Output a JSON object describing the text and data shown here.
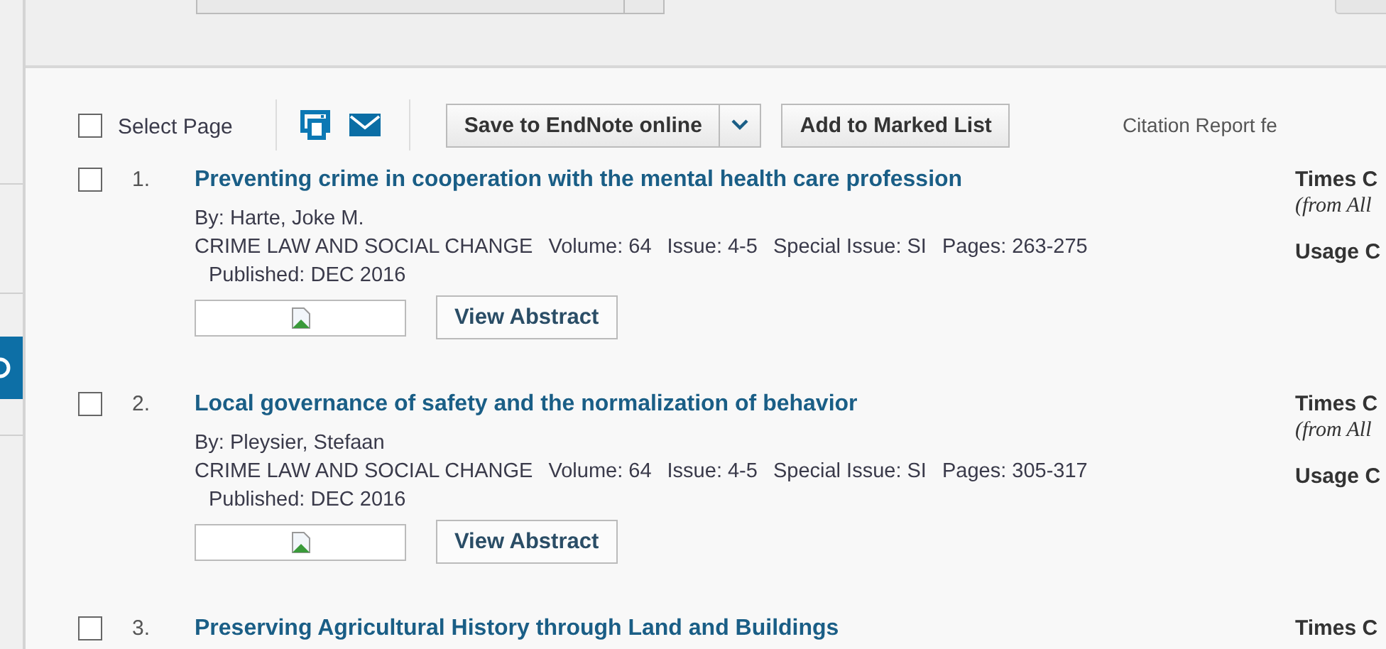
{
  "toolbar": {
    "select_page": {
      "label": "Select Page",
      "checked": false
    },
    "save_button": "Save to EndNote online",
    "add_button": "Add to Marked List",
    "citation_report": "Citation Report fe"
  },
  "records": [
    {
      "number": "1.",
      "checked": false,
      "title": "Preventing crime in cooperation with the mental health care profession",
      "authors": "By: Harte, Joke M.",
      "source": [
        "CRIME LAW AND SOCIAL CHANGE",
        "Volume: 64",
        "Issue: 4-5",
        "Special Issue: SI",
        "Pages: 263-275"
      ],
      "published": "Published: DEC 2016",
      "abstract_button": "View Abstract",
      "times_cited": "Times C",
      "from": "(from All",
      "usage": "Usage C"
    },
    {
      "number": "2.",
      "checked": false,
      "title": "Local governance of safety and the normalization of behavior",
      "authors": "By: Pleysier, Stefaan",
      "source": [
        "CRIME LAW AND SOCIAL CHANGE",
        "Volume: 64",
        "Issue: 4-5",
        "Special Issue: SI",
        "Pages: 305-317"
      ],
      "published": "Published: DEC 2016",
      "abstract_button": "View Abstract",
      "times_cited": "Times C",
      "from": "(from All",
      "usage": "Usage C"
    },
    {
      "number": "3.",
      "checked": false,
      "title": "Preserving Agricultural History through Land and Buildings",
      "times_cited": "Times C"
    }
  ]
}
